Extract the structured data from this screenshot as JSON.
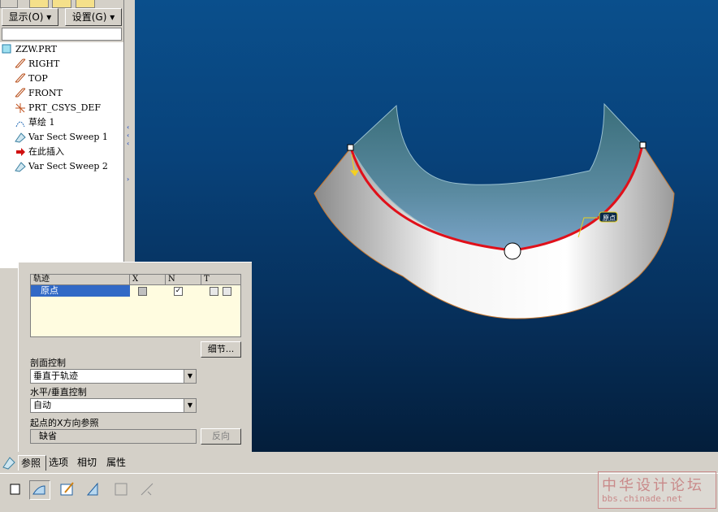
{
  "tree": {
    "menu_show": "显示(O)",
    "menu_settings": "设置(G)",
    "items": [
      {
        "label": "ZZW.PRT",
        "icon": "part-icon"
      },
      {
        "label": "RIGHT",
        "icon": "datum-plane-icon"
      },
      {
        "label": "TOP",
        "icon": "datum-plane-icon"
      },
      {
        "label": "FRONT",
        "icon": "datum-plane-icon"
      },
      {
        "label": "PRT_CSYS_DEF",
        "icon": "csys-icon"
      },
      {
        "label": "草绘 1",
        "icon": "sketch-icon"
      },
      {
        "label": "Var Sect Sweep 1",
        "icon": "sweep-icon"
      },
      {
        "label": "在此插入",
        "icon": "insert-arrow-icon"
      },
      {
        "label": "Var Sect Sweep 2",
        "icon": "sweep-icon"
      }
    ]
  },
  "viewport": {
    "origin_label": "原点"
  },
  "dash": {
    "table_headers": [
      "轨迹",
      "X",
      "N",
      "T"
    ],
    "row_name": "原点",
    "details_button": "细节...",
    "section_control_label": "剖面控制",
    "section_control_value": "垂直于轨迹",
    "hv_control_label": "水平/垂直控制",
    "hv_control_value": "自动",
    "xdir_label": "起点的X方向参照",
    "xdir_value": "缺省",
    "flip_button": "反向"
  },
  "tabs": [
    "参照",
    "选项",
    "相切",
    "属性"
  ],
  "watermark": {
    "line1": "中华设计论坛",
    "line2": "bbs.chinade.net"
  },
  "colors": {
    "viewport_top": "#0a4f8c",
    "viewport_bottom": "#041e3b",
    "trajectory": "#e0101a",
    "selection": "#3169c6"
  }
}
